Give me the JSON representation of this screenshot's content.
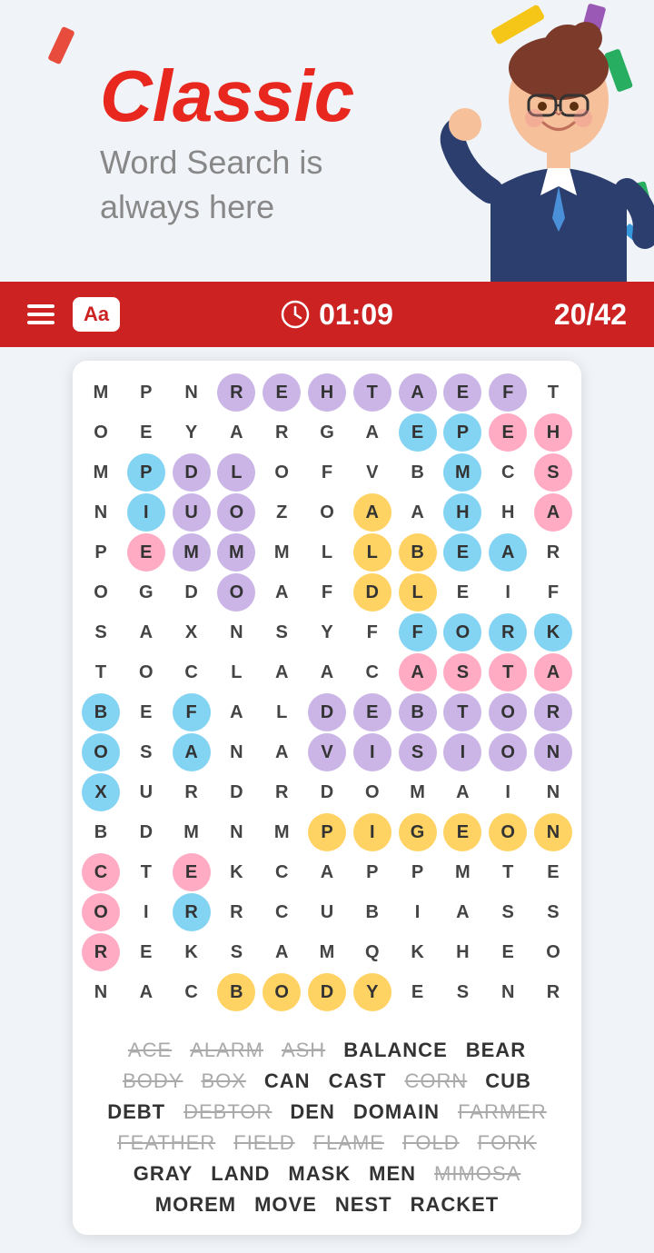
{
  "header": {
    "title": "Classic",
    "subtitle_line1": "Word Search is",
    "subtitle_line2": "always here"
  },
  "toolbar": {
    "menu_label": "Menu",
    "font_label": "Aa",
    "timer": "01:09",
    "score": "20/42"
  },
  "grid": {
    "rows": [
      [
        "M",
        "P",
        "N",
        "R",
        "E",
        "H",
        "T",
        "A",
        "E",
        "F",
        "T"
      ],
      [
        "O",
        "E",
        "Y",
        "A",
        "R",
        "G",
        "A",
        "E",
        "P",
        "E",
        "H"
      ],
      [
        "M",
        "P",
        "D",
        "L",
        "O",
        "F",
        "V",
        "B",
        "M",
        "C",
        "S"
      ],
      [
        "N",
        "I",
        "U",
        "O",
        "Z",
        "O",
        "A",
        "A",
        "H",
        "H",
        "A"
      ],
      [
        "P",
        "E",
        "M",
        "M",
        "M",
        "L",
        "L",
        "B",
        "E",
        "A",
        "R"
      ],
      [
        "O",
        "G",
        "D",
        "O",
        "A",
        "F",
        "D",
        "L",
        "E",
        "I",
        "F"
      ],
      [
        "S",
        "A",
        "X",
        "N",
        "S",
        "Y",
        "F",
        "F",
        "O",
        "R",
        "K"
      ],
      [
        "T",
        "O",
        "C",
        "L",
        "A",
        "A",
        "C",
        "A",
        "S",
        "T",
        "A"
      ],
      [
        "B",
        "E",
        "F",
        "A",
        "L",
        "D",
        "E",
        "B",
        "T",
        "O",
        "R"
      ],
      [
        "O",
        "S",
        "A",
        "N",
        "A",
        "V",
        "I",
        "S",
        "I",
        "O",
        "N"
      ],
      [
        "X",
        "U",
        "R",
        "D",
        "R",
        "D",
        "O",
        "M",
        "A",
        "I",
        "N"
      ],
      [
        "B",
        "D",
        "M",
        "N",
        "M",
        "P",
        "I",
        "G",
        "E",
        "O",
        "N"
      ],
      [
        "C",
        "T",
        "E",
        "K",
        "C",
        "A",
        "P",
        "P",
        "M",
        "T",
        "E"
      ],
      [
        "O",
        "I",
        "R",
        "R",
        "C",
        "U",
        "B",
        "I",
        "A",
        "S",
        "S"
      ],
      [
        "R",
        "E",
        "K",
        "S",
        "A",
        "M",
        "Q",
        "K",
        "H",
        "E",
        "O"
      ],
      [
        "N",
        "A",
        "C",
        "B",
        "O",
        "D",
        "Y",
        "E",
        "S",
        "N",
        "R"
      ]
    ],
    "highlights": {
      "rehtaef": {
        "color": "purple",
        "cells": [
          [
            0,
            3
          ],
          [
            0,
            4
          ],
          [
            0,
            5
          ],
          [
            0,
            6
          ],
          [
            0,
            7
          ],
          [
            0,
            8
          ],
          [
            0,
            9
          ]
        ]
      },
      "fork": {
        "color": "blue",
        "cells": [
          [
            6,
            7
          ],
          [
            6,
            8
          ],
          [
            6,
            9
          ],
          [
            6,
            10
          ]
        ]
      },
      "debtor": {
        "color": "purple",
        "cells": [
          [
            8,
            5
          ],
          [
            8,
            6
          ],
          [
            8,
            7
          ],
          [
            8,
            8
          ],
          [
            8,
            9
          ],
          [
            8,
            10
          ]
        ]
      },
      "vision": {
        "color": "purple",
        "cells": [
          [
            9,
            5
          ],
          [
            9,
            6
          ],
          [
            9,
            7
          ],
          [
            9,
            8
          ],
          [
            9,
            9
          ],
          [
            9,
            10
          ]
        ]
      },
      "pigeon": {
        "color": "yellow",
        "cells": [
          [
            11,
            5
          ],
          [
            11,
            6
          ],
          [
            11,
            7
          ],
          [
            11,
            8
          ],
          [
            11,
            9
          ],
          [
            11,
            10
          ]
        ]
      },
      "body": {
        "color": "yellow",
        "cells": [
          [
            15,
            3
          ],
          [
            15,
            4
          ],
          [
            15,
            5
          ],
          [
            15,
            6
          ]
        ]
      },
      "box": {
        "color": "blue",
        "cells": [
          [
            8,
            0
          ],
          [
            9,
            0
          ],
          [
            10,
            0
          ]
        ]
      },
      "can": {
        "color": "blue",
        "cells": [
          [
            12,
            0
          ],
          [
            13,
            0
          ],
          [
            14,
            0
          ]
        ]
      },
      "cast": {
        "color": "pink",
        "cells": [
          [
            7,
            7
          ],
          [
            7,
            8
          ],
          [
            7,
            9
          ],
          [
            7,
            10
          ]
        ]
      }
    }
  },
  "word_list": [
    {
      "word": "ACE",
      "found": true
    },
    {
      "word": "ALARM",
      "found": true
    },
    {
      "word": "ASH",
      "found": true
    },
    {
      "word": "BALANCE",
      "found": false
    },
    {
      "word": "BEAR",
      "found": false
    },
    {
      "word": "BODY",
      "found": true
    },
    {
      "word": "BOX",
      "found": true
    },
    {
      "word": "CAN",
      "found": false
    },
    {
      "word": "CAST",
      "found": false
    },
    {
      "word": "CORN",
      "found": true
    },
    {
      "word": "CUB",
      "found": false
    },
    {
      "word": "DEBT",
      "found": false
    },
    {
      "word": "DEBTOR",
      "found": true
    },
    {
      "word": "DEN",
      "found": false
    },
    {
      "word": "DOMAIN",
      "found": false
    },
    {
      "word": "FARMER",
      "found": true
    },
    {
      "word": "FEATHER",
      "found": true
    },
    {
      "word": "FIELD",
      "found": true
    },
    {
      "word": "FLAME",
      "found": true
    },
    {
      "word": "FOLD",
      "found": true
    },
    {
      "word": "FORK",
      "found": true
    },
    {
      "word": "GRAY",
      "found": false
    },
    {
      "word": "LAND",
      "found": false
    },
    {
      "word": "MASK",
      "found": false
    },
    {
      "word": "MEN",
      "found": false
    },
    {
      "word": "MIMOSA",
      "found": true
    },
    {
      "word": "MOREM",
      "found": false
    },
    {
      "word": "MOVE",
      "found": false
    },
    {
      "word": "NEST",
      "found": false
    },
    {
      "word": "RACKET",
      "found": false
    }
  ]
}
